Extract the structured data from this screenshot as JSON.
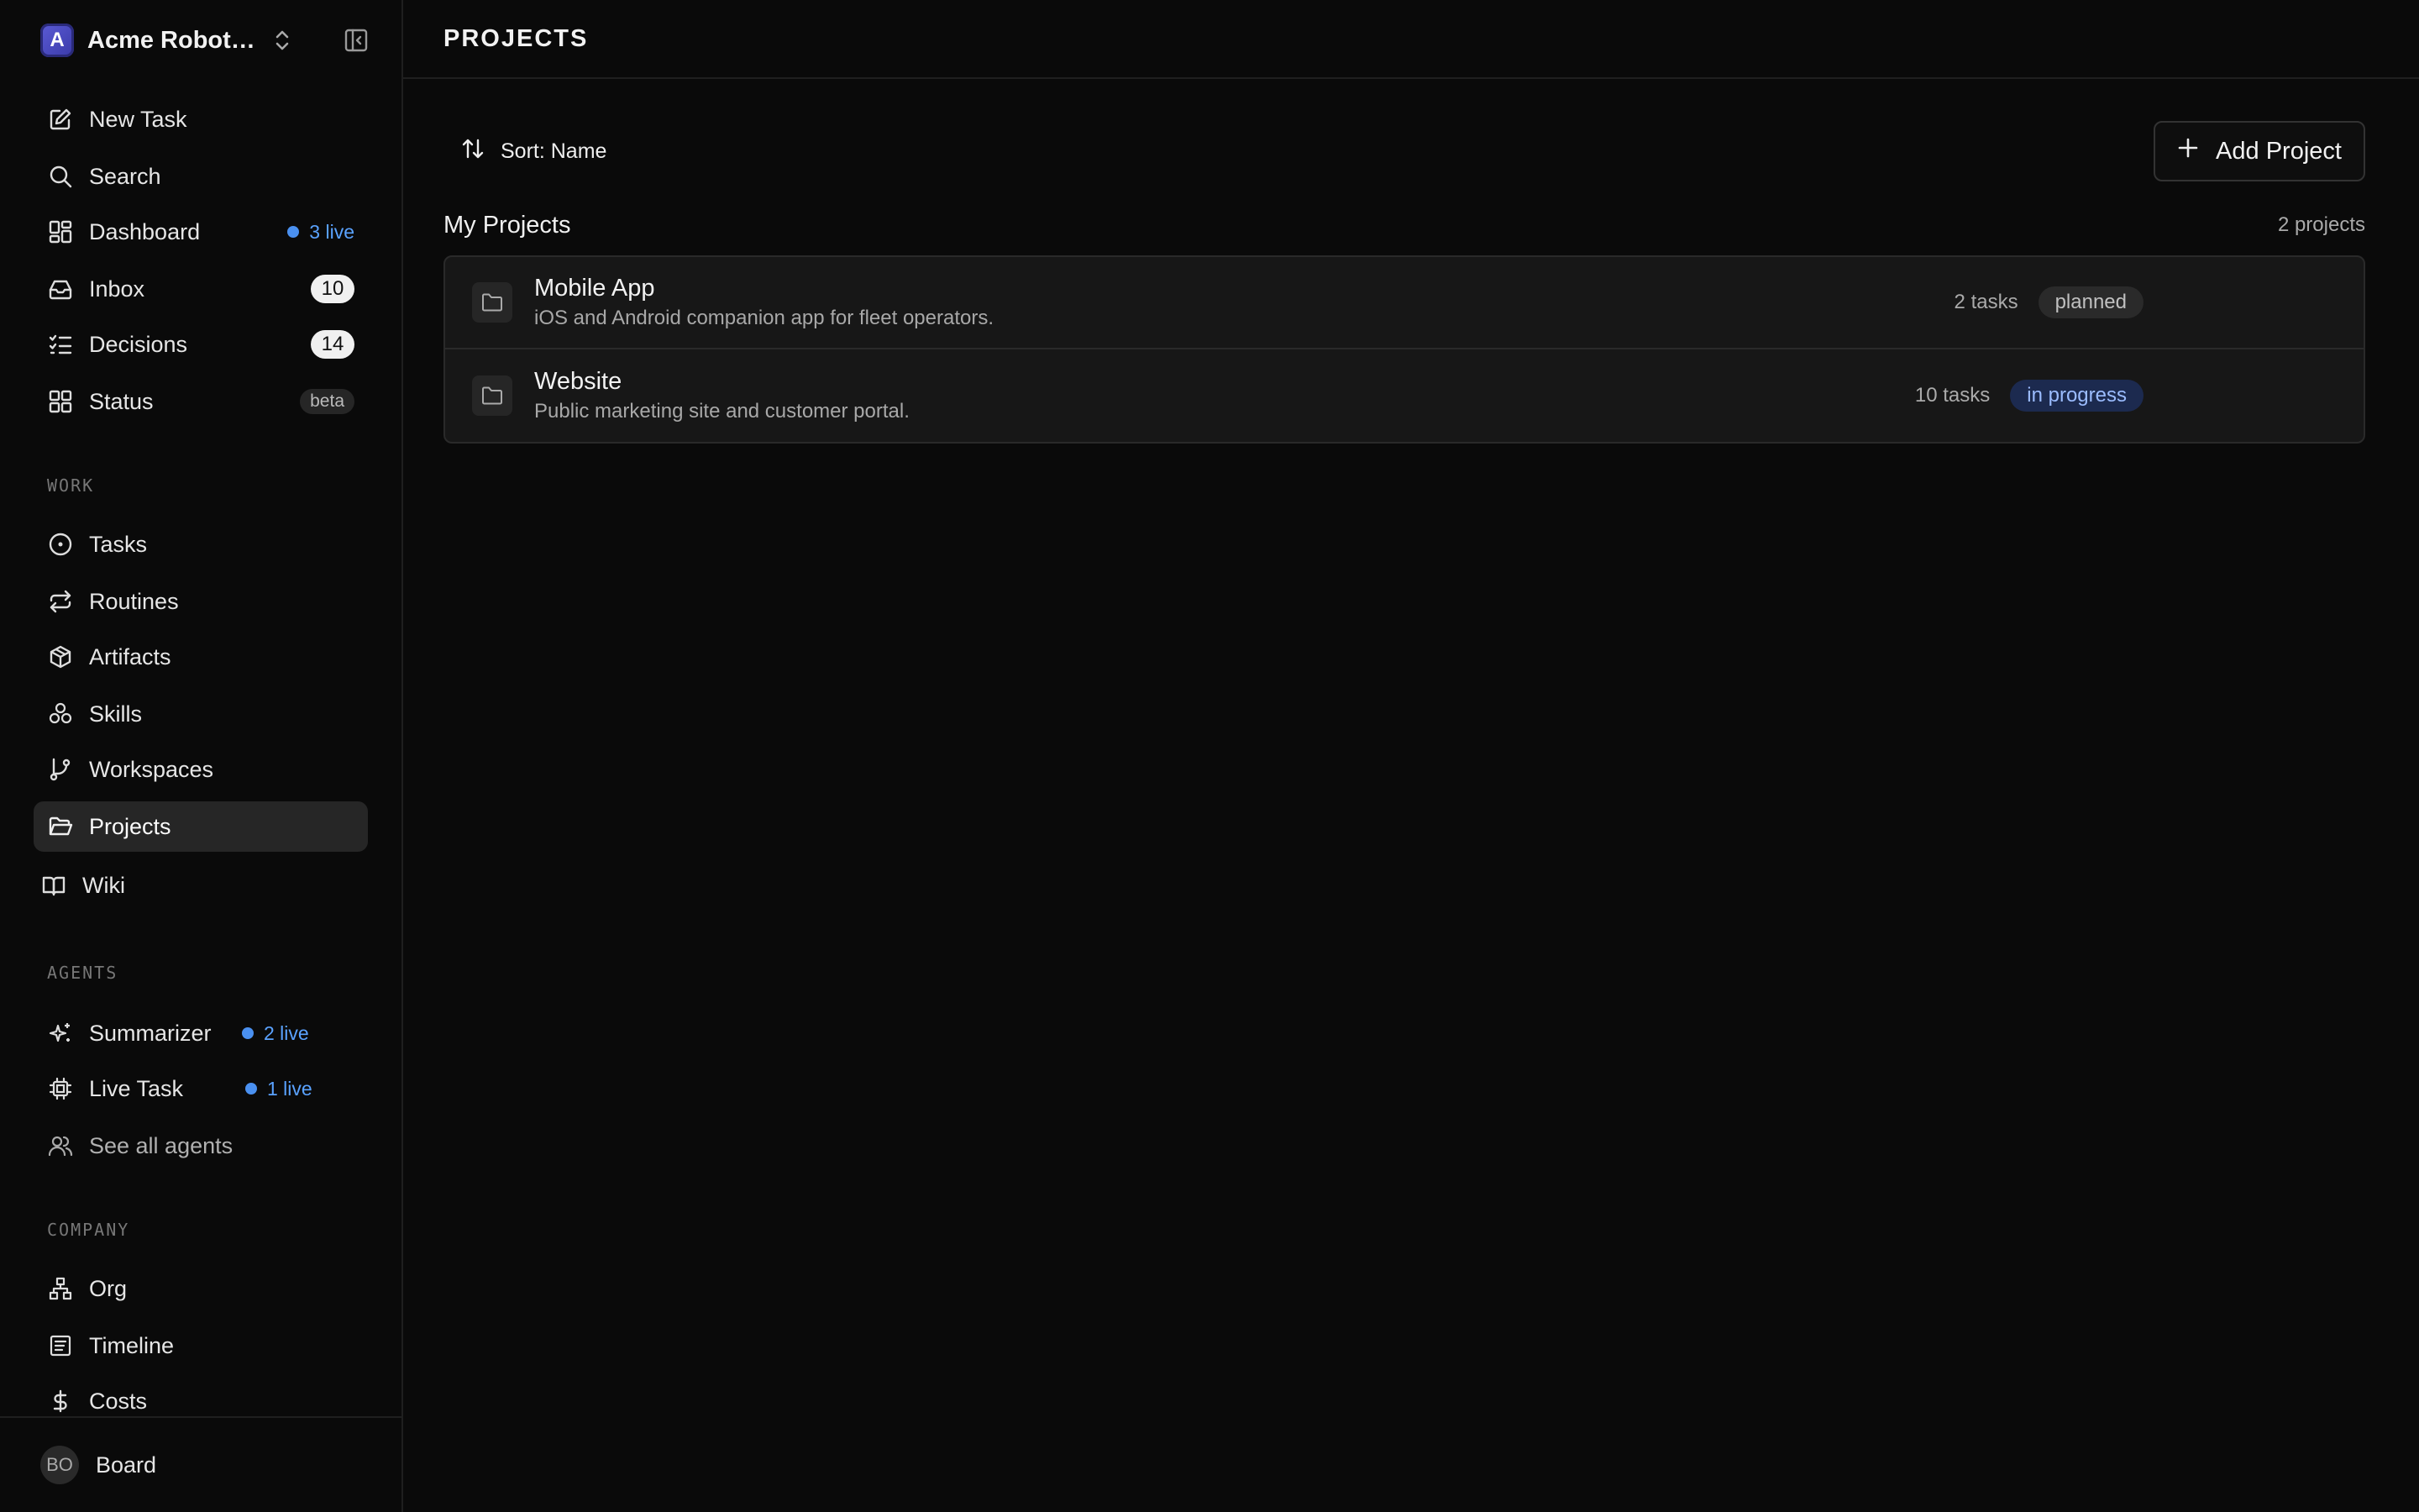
{
  "workspace": {
    "avatar_letter": "A",
    "name": "Acme Robotics"
  },
  "nav": {
    "new_task": "New Task",
    "search": "Search",
    "dashboard": "Dashboard",
    "dashboard_live": "3 live",
    "inbox": "Inbox",
    "inbox_count": "10",
    "decisions": "Decisions",
    "decisions_count": "14",
    "status": "Status",
    "status_badge": "beta"
  },
  "sections": {
    "work": "WORK",
    "agents": "AGENTS",
    "company": "COMPANY"
  },
  "work": {
    "tasks": "Tasks",
    "routines": "Routines",
    "artifacts": "Artifacts",
    "skills": "Skills",
    "workspaces": "Workspaces",
    "projects": "Projects",
    "wiki": "Wiki"
  },
  "agents": {
    "summarizer": "Summarizer",
    "summarizer_live": "2 live",
    "live_task": "Live Task",
    "live_task_live": "1 live",
    "see_all": "See all agents"
  },
  "company": {
    "org": "Org",
    "timeline": "Timeline",
    "costs": "Costs"
  },
  "footer": {
    "initials": "BO",
    "label": "Board"
  },
  "page": {
    "title": "PROJECTS"
  },
  "toolbar": {
    "sort_label": "Sort: Name",
    "add_label": "Add Project"
  },
  "group": {
    "title": "My Projects",
    "count": "2 projects"
  },
  "projects": [
    {
      "name": "Mobile App",
      "description": "iOS and Android companion app for fleet operators.",
      "tasks": "2 tasks",
      "status": "planned"
    },
    {
      "name": "Website",
      "description": "Public marketing site and customer portal.",
      "tasks": "10 tasks",
      "status": "in progress"
    }
  ],
  "colors": {
    "accent_live": "#4a90f0",
    "in_progress_bg": "#1c2a4f",
    "in_progress_text": "#9bbcff"
  }
}
